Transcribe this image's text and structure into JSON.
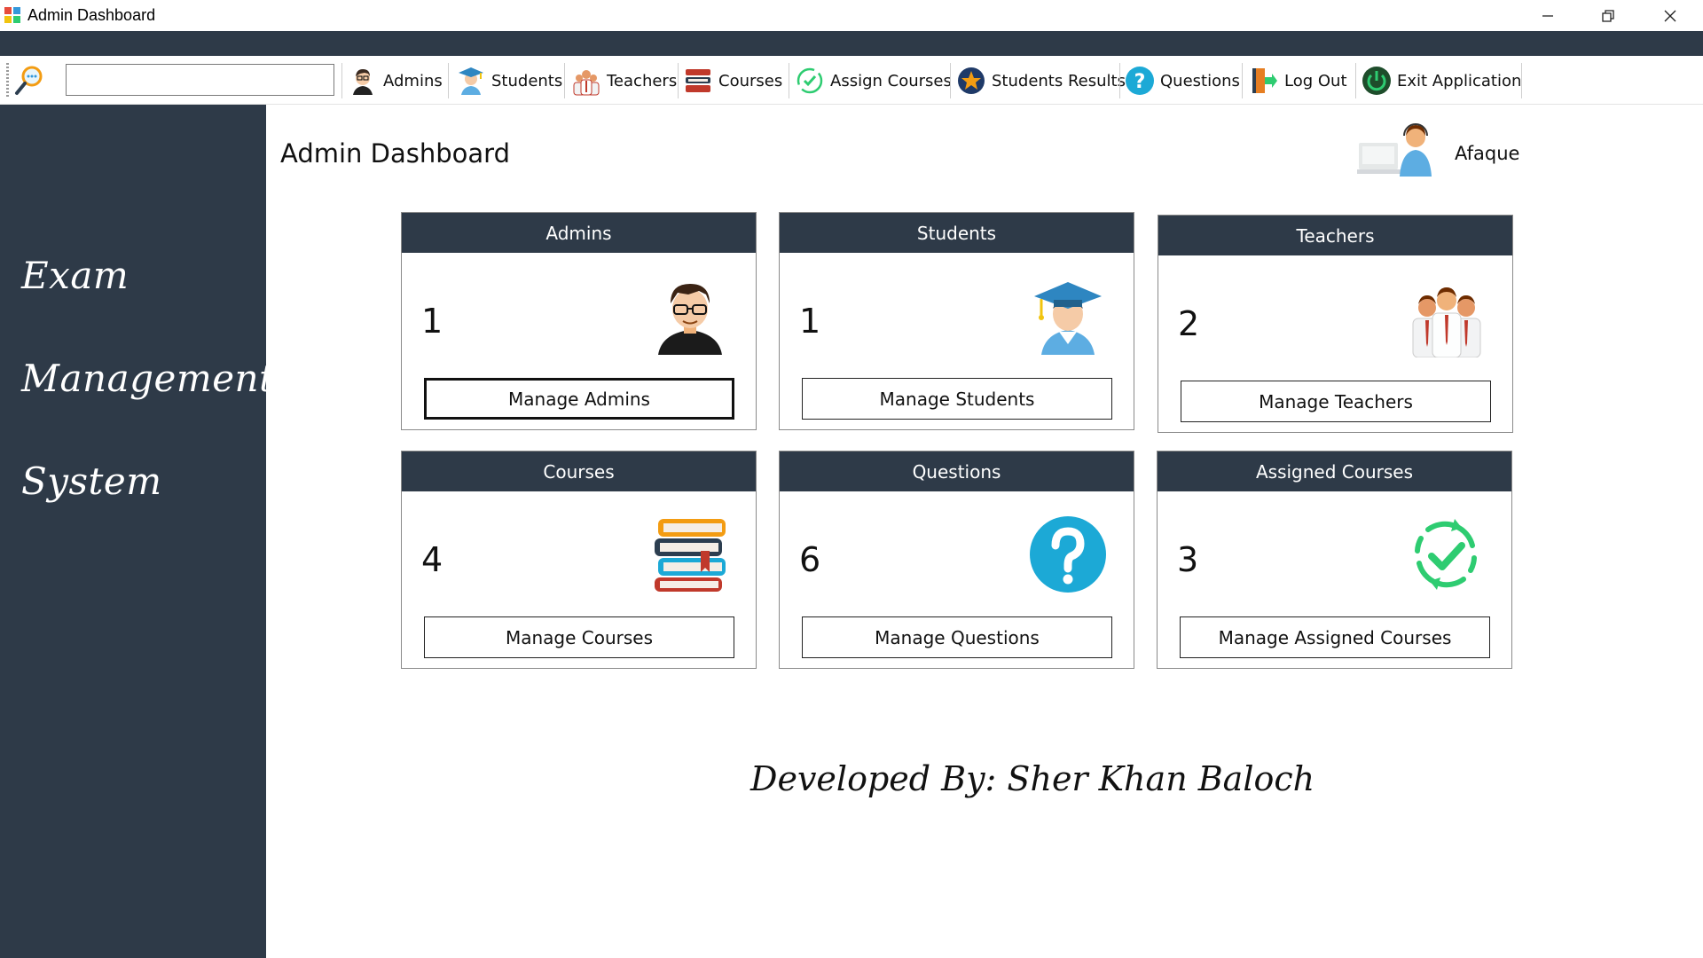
{
  "window": {
    "title": "Admin Dashboard",
    "controls": [
      "minimize-icon",
      "restore-icon",
      "close-icon"
    ]
  },
  "toolbar": {
    "search_value": "",
    "items": [
      {
        "label": "Admins",
        "icon": "admin-icon"
      },
      {
        "label": "Students",
        "icon": "student-icon"
      },
      {
        "label": "Teachers",
        "icon": "teachers-icon"
      },
      {
        "label": "Courses",
        "icon": "books-icon"
      },
      {
        "label": "Assign Courses",
        "icon": "check-cycle-icon"
      },
      {
        "label": "Students Results",
        "icon": "medal-icon"
      },
      {
        "label": "Questions",
        "icon": "question-icon"
      },
      {
        "label": "Log Out",
        "icon": "logout-icon"
      },
      {
        "label": "Exit Application",
        "icon": "power-icon"
      }
    ]
  },
  "sidebar": {
    "lines": [
      "Exam",
      "Management",
      "System"
    ]
  },
  "header": {
    "title": "Admin Dashboard",
    "user_name": "Afaque"
  },
  "cards": [
    {
      "title": "Admins",
      "count": "1",
      "button": "Manage Admins",
      "icon": "admin-avatar-icon"
    },
    {
      "title": "Students",
      "count": "1",
      "button": "Manage Students",
      "icon": "graduate-icon"
    },
    {
      "title": "Teachers",
      "count": "2",
      "button": "Manage Teachers",
      "icon": "teachers-group-icon"
    },
    {
      "title": "Courses",
      "count": "4",
      "button": "Manage Courses",
      "icon": "book-stack-icon"
    },
    {
      "title": "Questions",
      "count": "6",
      "button": "Manage Questions",
      "icon": "question-circle-icon"
    },
    {
      "title": "Assigned Courses",
      "count": "3",
      "button": "Manage Assigned Courses",
      "icon": "check-cycle-icon"
    }
  ],
  "footer": {
    "credit": "Developed By: Sher Khan Baloch"
  },
  "colors": {
    "dark": "#2e3a48",
    "accent_blue": "#1ca9d6",
    "accent_green": "#2ecc71"
  }
}
